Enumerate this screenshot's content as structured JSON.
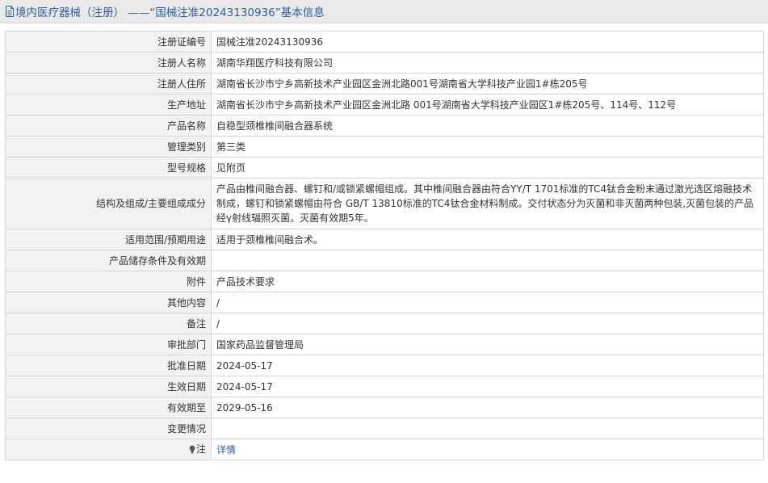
{
  "header": {
    "title": "境内医疗器械（注册） ——“国械注准20243130936”基本信息",
    "icon": "document-icon"
  },
  "rows": [
    {
      "label": "注册证编号",
      "value": "国械注准20243130936"
    },
    {
      "label": "注册人名称",
      "value": "湖南华翔医疗科技有限公司"
    },
    {
      "label": "注册人住所",
      "value": "湖南省长沙市宁乡高新技术产业园区金洲北路001号湖南省大学科技产业园1#栋205号"
    },
    {
      "label": "生产地址",
      "value": "湖南省长沙市宁乡高新技术产业园区金洲北路 001号湖南省大学科技产业园区1#栋205号、114号、112号"
    },
    {
      "label": "产品名称",
      "value": "自稳型颈椎椎间融合器系统"
    },
    {
      "label": "管理类别",
      "value": "第三类"
    },
    {
      "label": "型号规格",
      "value": "见附页"
    },
    {
      "label": "结构及组成/主要组成成分",
      "value": "产品由椎间融合器、螺钉和/或锁紧螺帽组成。其中椎间融合器由符合YY/T 1701标准的TC4钛合金粉末通过激光选区熔融技术制成，螺钉和锁紧螺帽由符合 GB/T 13810标准的TC4钛合金材料制成。交付状态分为灭菌和非灭菌两种包装,灭菌包装的产品经γ射线辐照灭菌。灭菌有效期5年。"
    },
    {
      "label": "适用范围/预期用途",
      "value": "适用于颈椎椎间融合术。"
    },
    {
      "label": "产品储存条件及有效期",
      "value": ""
    },
    {
      "label": "附件",
      "value": "产品技术要求"
    },
    {
      "label": "其他内容",
      "value": "/"
    },
    {
      "label": "备注",
      "value": "/"
    },
    {
      "label": "审批部门",
      "value": "国家药品监督管理局"
    },
    {
      "label": "批准日期",
      "value": "2024-05-17"
    },
    {
      "label": "生效日期",
      "value": "2024-05-17"
    },
    {
      "label": "有效期至",
      "value": "2029-05-16"
    },
    {
      "label": "变更情况",
      "value": ""
    }
  ],
  "note": {
    "label": "注",
    "icon": "lightbulb-icon",
    "link_text": "详情"
  },
  "colors": {
    "header_bg": "#e9e9e9",
    "header_text": "#2c5f9e",
    "label_bg": "#f2f2f2",
    "border": "#d4d4d4",
    "link": "#2c5f9e"
  }
}
